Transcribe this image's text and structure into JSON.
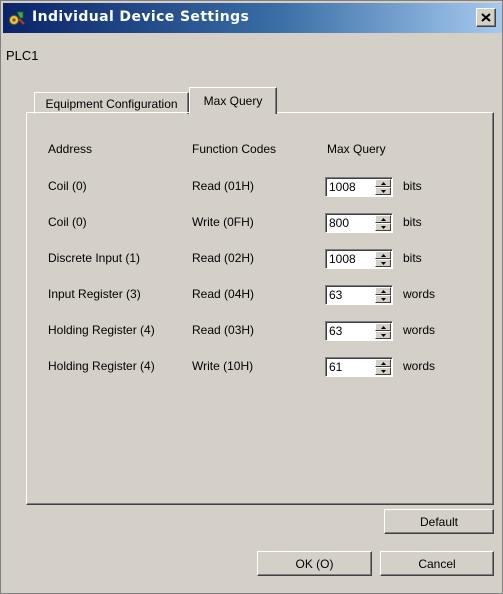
{
  "window": {
    "title": "Individual Device Settings",
    "device_name": "PLC1",
    "close_icon": "close-icon",
    "app_icon": "device-settings-icon"
  },
  "tabs": [
    {
      "label": "Equipment Configuration",
      "selected": false
    },
    {
      "label": "Max Query",
      "selected": true
    }
  ],
  "table": {
    "headers": {
      "address": "Address",
      "function": "Function Codes",
      "max_query": "Max Query"
    },
    "rows": [
      {
        "address": "Coil (0)",
        "function": "Read (01H)",
        "value": "1008",
        "unit": "bits"
      },
      {
        "address": "Coil (0)",
        "function": "Write (0FH)",
        "value": "800",
        "unit": "bits"
      },
      {
        "address": "Discrete Input (1)",
        "function": "Read (02H)",
        "value": "1008",
        "unit": "bits"
      },
      {
        "address": "Input Register (3)",
        "function": "Read (04H)",
        "value": "63",
        "unit": "words"
      },
      {
        "address": "Holding Register (4)",
        "function": "Read (03H)",
        "value": "63",
        "unit": "words"
      },
      {
        "address": "Holding Register (4)",
        "function": "Write (10H)",
        "value": "61",
        "unit": "words"
      }
    ]
  },
  "buttons": {
    "default_label": "Default",
    "ok_label": "OK (O)",
    "cancel_label": "Cancel"
  }
}
